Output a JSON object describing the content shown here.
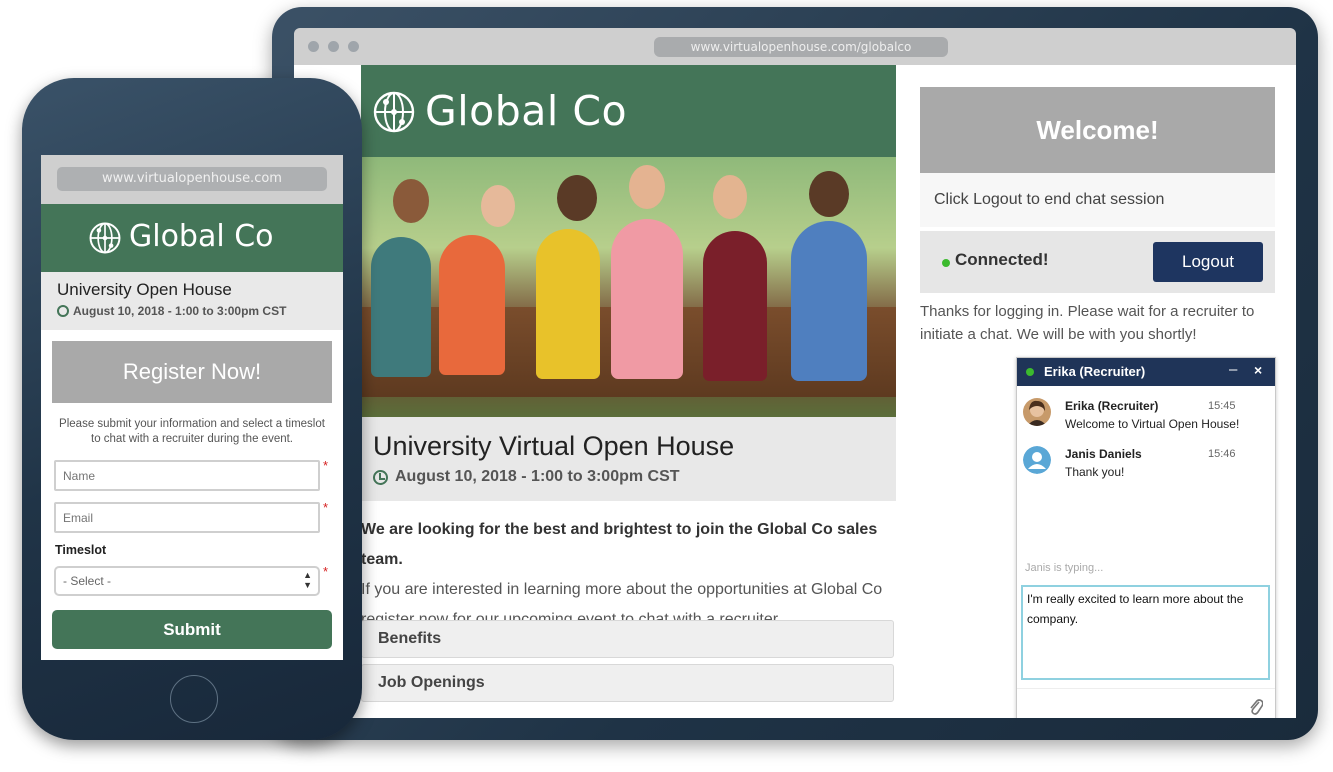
{
  "desktop": {
    "url": "www.virtualopenhouse.com/globalco",
    "brand": {
      "name": "Global Co"
    },
    "event": {
      "title": "University  Virtual Open House",
      "date": "August 10, 2018 - 1:00 to 3:00pm CST"
    },
    "intro": {
      "bold": "We are looking for the best and brightest to join the Global Co sales team.",
      "body": "If you are interested in learning more about the opportunities at Global Co register now for our upcoming event to chat with a recruiter."
    },
    "accordion": [
      "Benefits",
      "Job Openings"
    ],
    "sidebar": {
      "welcome": "Welcome!",
      "logout_hint": "Click Logout to end chat session",
      "status": "Connected!",
      "logout_label": "Logout",
      "thanks": "Thanks for logging in. Please wait for a recruiter to initiate a chat. We will be with you shortly!"
    },
    "chat": {
      "title": "Erika (Recruiter)",
      "minimize": "–",
      "close": "×",
      "messages": [
        {
          "name": "Erika (Recruiter)",
          "time": "15:45",
          "text": "Welcome to Virtual Open House!"
        },
        {
          "name": "Janis Daniels",
          "time": "15:46",
          "text": "Thank you!"
        }
      ],
      "typing": "Janis is typing...",
      "input_value": "I'm really excited to learn more about the company."
    }
  },
  "mobile": {
    "url": "www.virtualopenhouse.com",
    "brand": {
      "name": "Global Co"
    },
    "event": {
      "title": "University Open House",
      "date": "August 10, 2018 - 1:00 to 3:00pm CST"
    },
    "register": "Register Now!",
    "description": "Please submit your information and select a timeslot to chat with a recruiter during the event.",
    "form": {
      "name_placeholder": "Name",
      "email_placeholder": "Email",
      "required_mark": "*",
      "timeslot_label": "Timeslot",
      "timeslot_value": "- Select -",
      "submit": "Submit"
    }
  },
  "colors": {
    "brand_green": "#447558",
    "navy": "#1e3560",
    "gray_panel": "#a9a9a9",
    "online": "#3cba2e"
  }
}
